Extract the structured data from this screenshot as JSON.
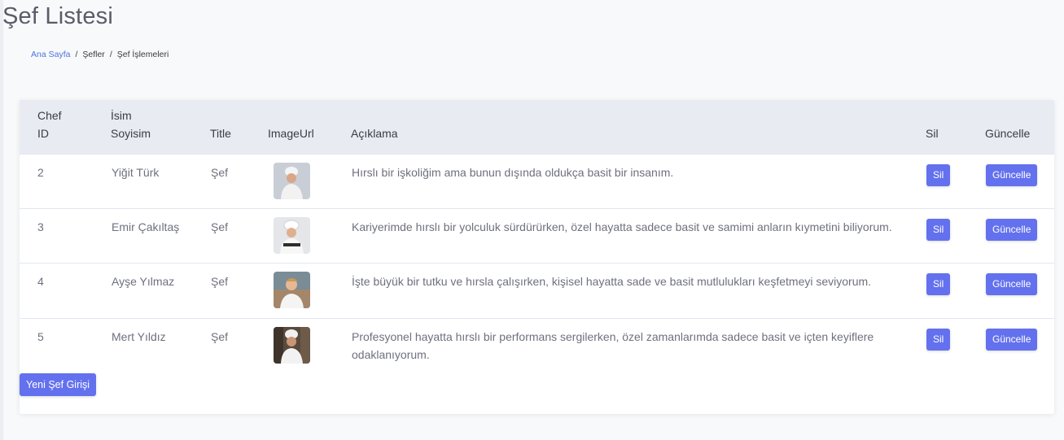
{
  "page": {
    "title": "Şef Listesi"
  },
  "breadcrumb": {
    "home": "Ana Sayfa",
    "section": "Şefler",
    "current": "Şef İşlemeleri",
    "separator": "/"
  },
  "table": {
    "headers": {
      "id_line1": "Chef",
      "id_line2": "ID",
      "name_line1": "İsim",
      "name_line2": "Soyisim",
      "title": "Title",
      "image": "ImageUrl",
      "description": "Açıklama",
      "delete": "Sil",
      "update": "Güncelle"
    },
    "rows": [
      {
        "id": "2",
        "name": "Yiğit Türk",
        "title": "Şef",
        "image_icon": "chef-photo-icon",
        "description": "Hırslı bir işkoliğim ama bunun dışında oldukça basit bir insanım.",
        "delete_label": "Sil",
        "update_label": "Güncelle"
      },
      {
        "id": "3",
        "name": "Emir Çakıltaş",
        "title": "Şef",
        "image_icon": "chef-photo-icon",
        "description": "Kariyerimde hırslı bir yolculuk sürdürürken, özel hayatta sadece basit ve samimi anların kıymetini biliyorum.",
        "delete_label": "Sil",
        "update_label": "Güncelle"
      },
      {
        "id": "4",
        "name": "Ayşe Yılmaz",
        "title": "Şef",
        "image_icon": "chef-photo-icon",
        "description": "İşte büyük bir tutku ve hırsla çalışırken, kişisel hayatta sade ve basit mutlulukları keşfetmeyi seviyorum.",
        "delete_label": "Sil",
        "update_label": "Güncelle"
      },
      {
        "id": "5",
        "name": "Mert Yıldız",
        "title": "Şef",
        "image_icon": "chef-photo-icon",
        "description": "Profesyonel hayatta hırslı bir performans sergilerken, özel zamanlarımda sadece basit ve içten keyiflere odaklanıyorum.",
        "delete_label": "Sil",
        "update_label": "Güncelle"
      }
    ]
  },
  "actions": {
    "new_chef": "Yeni Şef Girişi"
  },
  "colors": {
    "primary_button": "#6371ee",
    "link": "#4e73df",
    "table_header_bg": "#e9ebf2"
  }
}
